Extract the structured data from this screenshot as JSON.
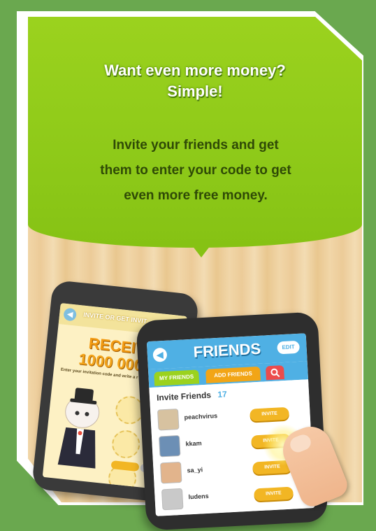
{
  "banner": {
    "headline_line1": "Want even more money?",
    "headline_line2": "Simple!",
    "body_line1": "Invite your friends and get",
    "body_line2": "them to enter your code to get",
    "body_line3": "even more free money."
  },
  "left_phone": {
    "header_title": "INVITE OR GET INVIT",
    "receive_label": "RECEIVE",
    "amount": "1000 0000 !",
    "instruction": "Enter your invitation code and write a r"
  },
  "right_phone": {
    "title": "FRIENDS",
    "edit_label": "EDIT",
    "tabs": [
      "MY FRIENDS",
      "ADD FRIENDS"
    ],
    "list_title": "Invite Friends",
    "list_count": "17",
    "invite_label": "INVITE",
    "friends": [
      "peachvirus",
      "kkam",
      "sa_yi",
      "ludens"
    ]
  },
  "colors": {
    "background": "#6aa84f",
    "banner_green": "#8cc818",
    "accent_blue": "#4fb0e4",
    "invite_orange": "#f2b624"
  },
  "icons": [
    "back-arrow-icon",
    "search-icon"
  ]
}
